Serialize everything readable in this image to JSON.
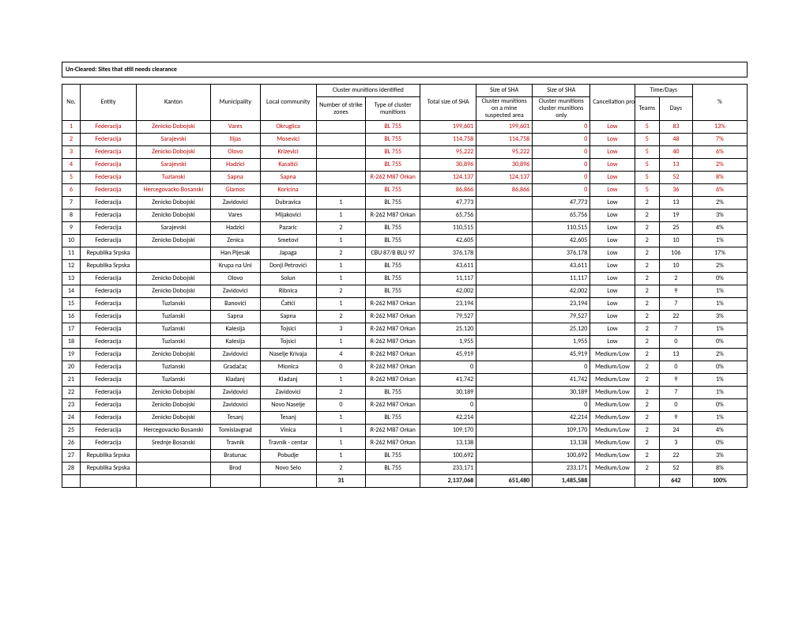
{
  "title": "Un-Cleared: Sites that still needs clearance",
  "headers": {
    "no": "No.",
    "entity": "Entity",
    "kanton": "Kanton",
    "municipality": "Municipality",
    "local": "Local community",
    "cm_group": "Cluster munitions identified",
    "strike": "Number of strike zones",
    "type": "Type of cluster munitions",
    "total": "Total size of SHA",
    "sha_mine": "Size of SHA",
    "sha_mine_sub": "Cluster munitions on a mine suspected area",
    "sha_only": "Size of SHA",
    "sha_only_sub": "Cluster munitions cluster munitions only",
    "cancel": "Cancellation probability",
    "time_group": "Time/Days",
    "teams": "Teams",
    "days": "Days",
    "pct": "%"
  },
  "rows": [
    {
      "red": true,
      "no": "1",
      "entity": "Federacija",
      "kanton": "Zenicko Dobojski",
      "muni": "Vares",
      "local": "Okruglica",
      "strike": "",
      "type": "BL 755",
      "total": "199,601",
      "mine": "199,601",
      "only": "0",
      "cancel": "Low",
      "teams": "5",
      "days": "83",
      "pct": "13%"
    },
    {
      "red": true,
      "no": "2",
      "entity": "Federacija",
      "kanton": "Sarajevski",
      "muni": "Ilijas",
      "local": "Mosevici",
      "strike": "",
      "type": "BL 755",
      "total": "114,758",
      "mine": "114,758",
      "only": "0",
      "cancel": "Low",
      "teams": "5",
      "days": "48",
      "pct": "7%"
    },
    {
      "red": true,
      "no": "3",
      "entity": "Federacija",
      "kanton": "Zenicko Dobojski",
      "muni": "Olovo",
      "local": "Krizevici",
      "strike": "",
      "type": "BL 755",
      "total": "95,222",
      "mine": "95,222",
      "only": "0",
      "cancel": "Low",
      "teams": "5",
      "days": "40",
      "pct": "6%"
    },
    {
      "red": true,
      "no": "4",
      "entity": "Federacija",
      "kanton": "Sarajevski",
      "muni": "Hadzici",
      "local": "Kasatići",
      "strike": "",
      "type": "BL 755",
      "total": "30,896",
      "mine": "30,896",
      "only": "0",
      "cancel": "Low",
      "teams": "5",
      "days": "13",
      "pct": "2%"
    },
    {
      "red": true,
      "no": "5",
      "entity": "Federacija",
      "kanton": "Tuzlanski",
      "muni": "Sapna",
      "local": "Sapna",
      "strike": "",
      "type": "R-262 M87 Orkan",
      "total": "124,137",
      "mine": "124,137",
      "only": "0",
      "cancel": "Low",
      "teams": "5",
      "days": "52",
      "pct": "8%"
    },
    {
      "red": true,
      "no": "6",
      "entity": "Federacija",
      "kanton": "Hercegovacko Bosanski",
      "muni": "Glamoc",
      "local": "Koricina",
      "strike": "",
      "type": "BL 755",
      "total": "86,866",
      "mine": "86,866",
      "only": "0",
      "cancel": "Low",
      "teams": "5",
      "days": "36",
      "pct": "6%"
    },
    {
      "no": "7",
      "entity": "Federacija",
      "kanton": "Zenicko Dobojski",
      "muni": "Zavidovici",
      "local": "Dubravica",
      "strike": "1",
      "type": "BL 755",
      "total": "47,773",
      "mine": "",
      "only": "47,773",
      "cancel": "Low",
      "teams": "2",
      "days": "13",
      "pct": "2%"
    },
    {
      "no": "8",
      "entity": "Federacija",
      "kanton": "Zenicko Dobojski",
      "muni": "Vares",
      "local": "Mijakovici",
      "strike": "1",
      "type": "R-262 M87 Orkan",
      "total": "65,756",
      "mine": "",
      "only": "65,756",
      "cancel": "Low",
      "teams": "2",
      "days": "19",
      "pct": "3%"
    },
    {
      "no": "9",
      "entity": "Federacija",
      "kanton": "Sarajevski",
      "muni": "Hadzici",
      "local": "Pazaric",
      "strike": "2",
      "type": "BL 755",
      "total": "110,515",
      "mine": "",
      "only": "110,515",
      "cancel": "Low",
      "teams": "2",
      "days": "25",
      "pct": "4%"
    },
    {
      "no": "10",
      "entity": "Federacija",
      "kanton": "Zenicko Dobojski",
      "muni": "Zenica",
      "local": "Smetovi",
      "strike": "1",
      "type": "BL 755",
      "total": "42,605",
      "mine": "",
      "only": "42,605",
      "cancel": "Low",
      "teams": "2",
      "days": "10",
      "pct": "1%"
    },
    {
      "no": "11",
      "entity": "Republika Srpska",
      "kanton": "",
      "muni": "Han Pijesak",
      "local": "Japaga",
      "strike": "2",
      "type": "CBU 87/B BLU 97",
      "total": "376,178",
      "mine": "",
      "only": "376,178",
      "cancel": "Low",
      "teams": "2",
      "days": "106",
      "pct": "17%"
    },
    {
      "no": "12",
      "entity": "Republika Srpska",
      "kanton": "",
      "muni": "Krupa na Uni",
      "local": "Donji Petrovići",
      "strike": "1",
      "type": "BL 755",
      "total": "43,611",
      "mine": "",
      "only": "43,611",
      "cancel": "Low",
      "teams": "2",
      "days": "10",
      "pct": "2%"
    },
    {
      "no": "13",
      "entity": "Federacija",
      "kanton": "Zenicko Dobojski",
      "muni": "Olovo",
      "local": "Solun",
      "strike": "1",
      "type": "BL 755",
      "total": "11,117",
      "mine": "",
      "only": "11,117",
      "cancel": "Low",
      "teams": "2",
      "days": "2",
      "pct": "0%"
    },
    {
      "no": "14",
      "entity": "Federacija",
      "kanton": "Zenicko Dobojski",
      "muni": "Zavidovici",
      "local": "Ribnica",
      "strike": "2",
      "type": "BL 755",
      "total": "42,002",
      "mine": "",
      "only": "42,002",
      "cancel": "Low",
      "teams": "2",
      "days": "9",
      "pct": "1%"
    },
    {
      "no": "15",
      "entity": "Federacija",
      "kanton": "Tuzlanski",
      "muni": "Banovići",
      "local": "Ćatići",
      "strike": "1",
      "type": "R-262 M87 Orkan",
      "total": "23,194",
      "mine": "",
      "only": "23,194",
      "cancel": "Low",
      "teams": "2",
      "days": "7",
      "pct": "1%"
    },
    {
      "no": "16",
      "entity": "Federacija",
      "kanton": "Tuzlanski",
      "muni": "Sapna",
      "local": "Sapna",
      "strike": "2",
      "type": "R-262 M87 Orkan",
      "total": "79,527",
      "mine": "",
      "only": "79,527",
      "cancel": "Low",
      "teams": "2",
      "days": "22",
      "pct": "3%"
    },
    {
      "no": "17",
      "entity": "Federacija",
      "kanton": "Tuzlanski",
      "muni": "Kalesija",
      "local": "Tojsici",
      "strike": "3",
      "type": "R-262 M87 Orkan",
      "total": "25,120",
      "mine": "",
      "only": "25,120",
      "cancel": "Low",
      "teams": "2",
      "days": "7",
      "pct": "1%"
    },
    {
      "no": "18",
      "entity": "Federacija",
      "kanton": "Tuzlanski",
      "muni": "Kalesija",
      "local": "Tojsici",
      "strike": "1",
      "type": "R-262 M87 Orkan",
      "total": "1,955",
      "mine": "",
      "only": "1,955",
      "cancel": "Low",
      "teams": "2",
      "days": "0",
      "pct": "0%"
    },
    {
      "no": "19",
      "entity": "Federacija",
      "kanton": "Zenicko Dobojski",
      "muni": "Zavidovici",
      "local": "Naselje Krivaja",
      "strike": "4",
      "type": "R-262 M87 Orkan",
      "total": "45,919",
      "mine": "",
      "only": "45,919",
      "cancel": "Medium/Low",
      "teams": "2",
      "days": "13",
      "pct": "2%"
    },
    {
      "no": "20",
      "entity": "Federacija",
      "kanton": "Tuzlanski",
      "muni": "Gradačac",
      "local": "Mionica",
      "strike": "0",
      "type": "R-262 M87 Orkan",
      "total": "0",
      "mine": "",
      "only": "0",
      "cancel": "Medium/Low",
      "teams": "2",
      "days": "0",
      "pct": "0%"
    },
    {
      "no": "21",
      "entity": "Federacija",
      "kanton": "Tuzlanski",
      "muni": "Kladanj",
      "local": "Kladanj",
      "strike": "1",
      "type": "R-262 M87 Orkan",
      "total": "41,742",
      "mine": "",
      "only": "41,742",
      "cancel": "Medium/Low",
      "teams": "2",
      "days": "9",
      "pct": "1%"
    },
    {
      "no": "22",
      "entity": "Federacija",
      "kanton": "Zenicko Dobojski",
      "muni": "Zavidovici",
      "local": "Zavidovici",
      "strike": "2",
      "type": "BL 755",
      "total": "30,189",
      "mine": "",
      "only": "30,189",
      "cancel": "Medium/Low",
      "teams": "2",
      "days": "7",
      "pct": "1%"
    },
    {
      "no": "23",
      "entity": "Federacija",
      "kanton": "Zenicko Dobojski",
      "muni": "Zavidovici",
      "local": "Novo Naselje",
      "strike": "0",
      "type": "R-262 M87 Orkan",
      "total": "0",
      "mine": "",
      "only": "0",
      "cancel": "Medium/Low",
      "teams": "2",
      "days": "0",
      "pct": "0%"
    },
    {
      "no": "24",
      "entity": "Federacija",
      "kanton": "Zenicko Dobojski",
      "muni": "Tesanj",
      "local": "Tesanj",
      "strike": "1",
      "type": "BL 755",
      "total": "42,214",
      "mine": "",
      "only": "42,214",
      "cancel": "Medium/Low",
      "teams": "2",
      "days": "9",
      "pct": "1%"
    },
    {
      "no": "25",
      "entity": "Federacija",
      "kanton": "Hercegovacko Bosanski",
      "muni": "Tomislavgrad",
      "local": "Vinica",
      "strike": "1",
      "type": "R-262 M87 Orkan",
      "total": "109,170",
      "mine": "",
      "only": "109,170",
      "cancel": "Medium/Low",
      "teams": "2",
      "days": "24",
      "pct": "4%"
    },
    {
      "no": "26",
      "entity": "Federacija",
      "kanton": "Srednje Bosanski",
      "muni": "Travnik",
      "local": "Travnik - centar",
      "strike": "1",
      "type": "R-262 M87 Orkan",
      "total": "13,138",
      "mine": "",
      "only": "13,138",
      "cancel": "Medium/Low",
      "teams": "2",
      "days": "3",
      "pct": "0%"
    },
    {
      "no": "27",
      "entity": "Republika Srpska",
      "kanton": "",
      "muni": "Bratunac",
      "local": "Pobudje",
      "strike": "1",
      "type": "BL 755",
      "total": "100,692",
      "mine": "",
      "only": "100,692",
      "cancel": "Medium/Low",
      "teams": "2",
      "days": "22",
      "pct": "3%"
    },
    {
      "no": "28",
      "entity": "Republika Srpska",
      "kanton": "",
      "muni": "Brod",
      "local": "Novo Selo",
      "strike": "2",
      "type": "BL 755",
      "total": "233,171",
      "mine": "",
      "only": "233,171",
      "cancel": "Medium/Low",
      "teams": "2",
      "days": "52",
      "pct": "8%"
    }
  ],
  "totals": {
    "strike": "31",
    "total": "2,137,068",
    "mine": "651,480",
    "only": "1,485,588",
    "days": "642",
    "pct": "100%"
  }
}
